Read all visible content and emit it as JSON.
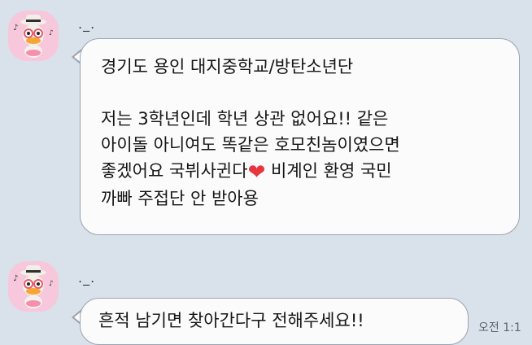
{
  "messages": [
    {
      "sender": "._.",
      "lines": [
        "경기도 용인 대지중학교/방탄소년단",
        "",
        "저는 3학년인데 학년 상관 없어요!! 같은",
        "아이돌 아니여도 똑같은 호모친놈이였으면",
        "좋겠어요 국뷔사귄다",
        "까빠 주접단 안 받아용"
      ],
      "line5_tail": " 비계인 환영 국민"
    },
    {
      "sender": "._.",
      "lines": [
        "흔적 남기면 찾아간다구 전해주세요!!"
      ],
      "time": "오전 1:1"
    }
  ],
  "icons": {
    "avatar": "duck-avatar-icon",
    "heart": "red-heart-emoji"
  },
  "colors": {
    "background": "#d9e1ea",
    "bubble": "#fbfbfc",
    "bubble_border": "#9aa4b0",
    "avatar_bg": "#f7c8dc",
    "heart": "#e8343c"
  }
}
